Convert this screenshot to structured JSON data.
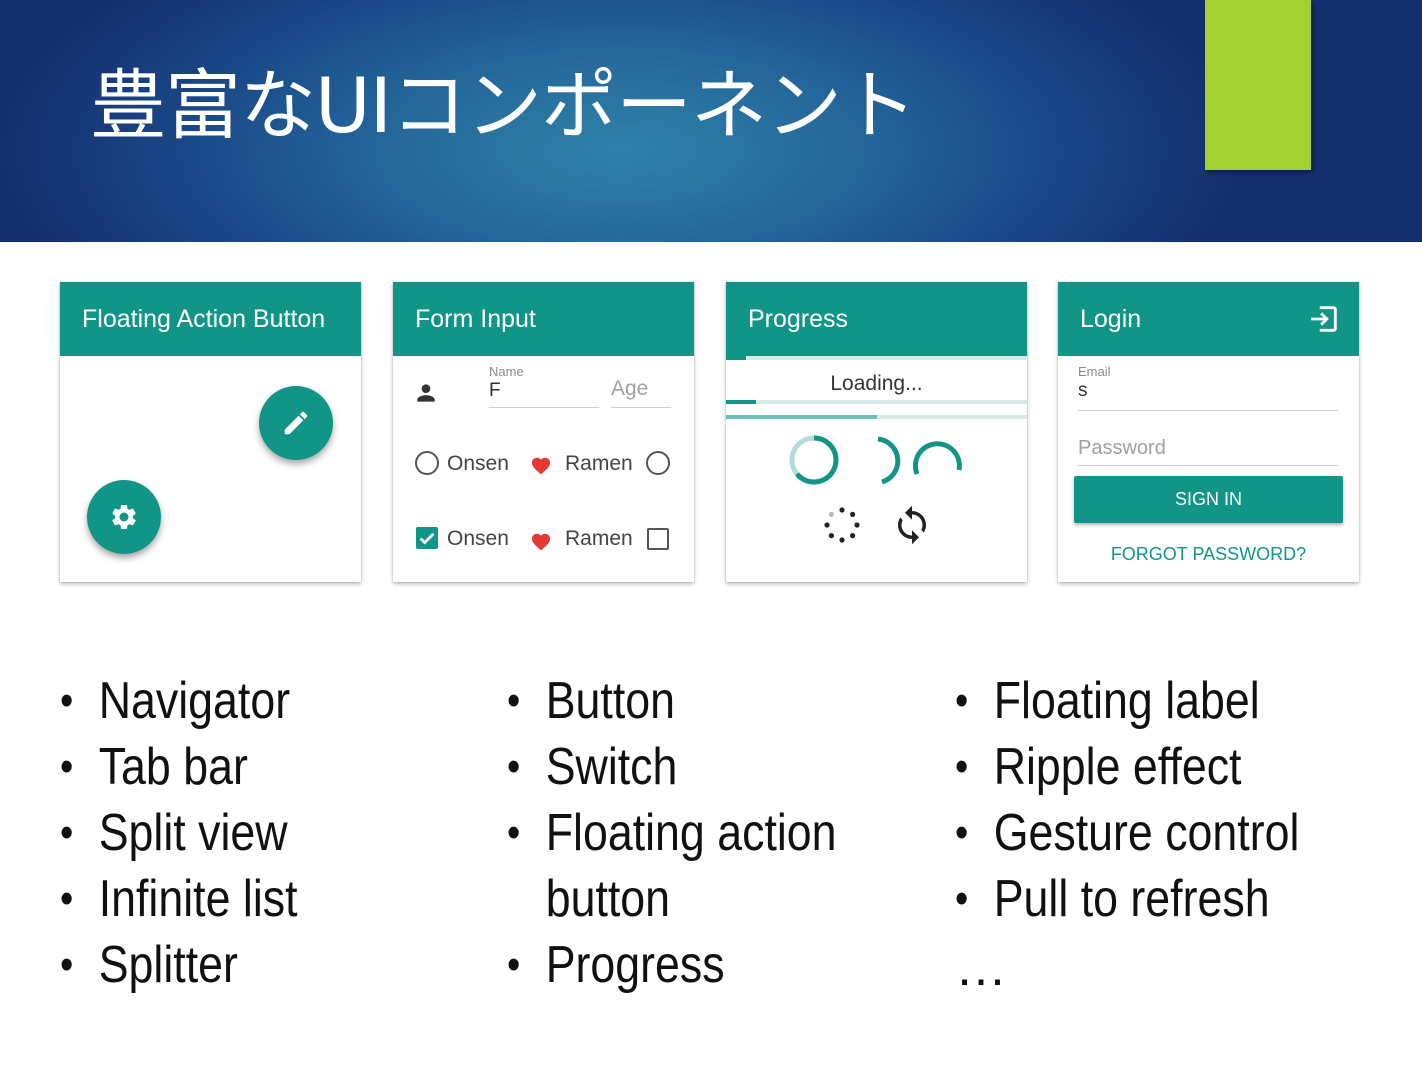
{
  "slide": {
    "title": "豊富なUIコンポーネント",
    "accent_color": "#a4cf30",
    "brand_color": "#119587"
  },
  "cards": {
    "fab": {
      "title": "Floating Action Button",
      "edit_icon": "pencil-icon",
      "settings_icon": "gear-icon"
    },
    "form": {
      "title": "Form Input",
      "name_label": "Name",
      "name_value": "F",
      "age_placeholder": "Age",
      "row1": {
        "left": "Onsen",
        "right": "Ramen"
      },
      "row2": {
        "left": "Onsen",
        "right": "Ramen"
      }
    },
    "progress": {
      "title": "Progress",
      "loading_text": "Loading...",
      "bar1_progress": 0.1,
      "bar2_progress": 0.5
    },
    "login": {
      "title": "Login",
      "email_label": "Email",
      "email_value": "s",
      "password_placeholder": "Password",
      "signin_label": "SIGN IN",
      "forgot_label": "FORGOT PASSWORD?",
      "login_icon": "sign-in-icon"
    }
  },
  "lists": {
    "col1": [
      "Navigator",
      "Tab bar",
      "Split view",
      "Infinite list",
      "Splitter"
    ],
    "col2": [
      "Button",
      "Switch",
      "Floating action",
      "button",
      "Progress"
    ],
    "col3": [
      "Floating label",
      "Ripple effect",
      "Gesture control",
      "Pull to refresh"
    ],
    "ellipsis": "…"
  }
}
